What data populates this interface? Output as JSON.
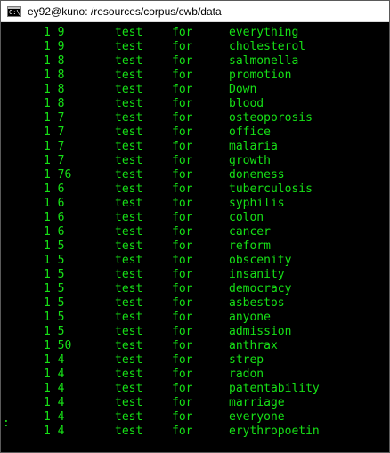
{
  "window": {
    "title": "ey92@kuno: /resources/corpus/cwb/data",
    "icon_label": "C:\\"
  },
  "terminal": {
    "prompt": ":",
    "rows": [
      {
        "count": "1 9",
        "col2": "test",
        "col3": "for",
        "word": "everything"
      },
      {
        "count": "1 9",
        "col2": "test",
        "col3": "for",
        "word": "cholesterol"
      },
      {
        "count": "1 8",
        "col2": "test",
        "col3": "for",
        "word": "salmonella"
      },
      {
        "count": "1 8",
        "col2": "test",
        "col3": "for",
        "word": "promotion"
      },
      {
        "count": "1 8",
        "col2": "test",
        "col3": "for",
        "word": "Down"
      },
      {
        "count": "1 8",
        "col2": "test",
        "col3": "for",
        "word": "blood"
      },
      {
        "count": "1 7",
        "col2": "test",
        "col3": "for",
        "word": "osteoporosis"
      },
      {
        "count": "1 7",
        "col2": "test",
        "col3": "for",
        "word": "office"
      },
      {
        "count": "1 7",
        "col2": "test",
        "col3": "for",
        "word": "malaria"
      },
      {
        "count": "1 7",
        "col2": "test",
        "col3": "for",
        "word": "growth"
      },
      {
        "count": "1 76",
        "col2": "test",
        "col3": "for",
        "word": "doneness"
      },
      {
        "count": "1 6",
        "col2": "test",
        "col3": "for",
        "word": "tuberculosis"
      },
      {
        "count": "1 6",
        "col2": "test",
        "col3": "for",
        "word": "syphilis"
      },
      {
        "count": "1 6",
        "col2": "test",
        "col3": "for",
        "word": "colon"
      },
      {
        "count": "1 6",
        "col2": "test",
        "col3": "for",
        "word": "cancer"
      },
      {
        "count": "1 5",
        "col2": "test",
        "col3": "for",
        "word": "reform"
      },
      {
        "count": "1 5",
        "col2": "test",
        "col3": "for",
        "word": "obscenity"
      },
      {
        "count": "1 5",
        "col2": "test",
        "col3": "for",
        "word": "insanity"
      },
      {
        "count": "1 5",
        "col2": "test",
        "col3": "for",
        "word": "democracy"
      },
      {
        "count": "1 5",
        "col2": "test",
        "col3": "for",
        "word": "asbestos"
      },
      {
        "count": "1 5",
        "col2": "test",
        "col3": "for",
        "word": "anyone"
      },
      {
        "count": "1 5",
        "col2": "test",
        "col3": "for",
        "word": "admission"
      },
      {
        "count": "1 50",
        "col2": "test",
        "col3": "for",
        "word": "anthrax"
      },
      {
        "count": "1 4",
        "col2": "test",
        "col3": "for",
        "word": "strep"
      },
      {
        "count": "1 4",
        "col2": "test",
        "col3": "for",
        "word": "radon"
      },
      {
        "count": "1 4",
        "col2": "test",
        "col3": "for",
        "word": "patentability"
      },
      {
        "count": "1 4",
        "col2": "test",
        "col3": "for",
        "word": "marriage"
      },
      {
        "count": "1 4",
        "col2": "test",
        "col3": "for",
        "word": "everyone"
      },
      {
        "count": "1 4",
        "col2": "test",
        "col3": "for",
        "word": "erythropoetin"
      }
    ]
  },
  "colors": {
    "terminal_background": "#000000",
    "terminal_text": "#16e016",
    "titlebar_background": "#ffffff"
  }
}
